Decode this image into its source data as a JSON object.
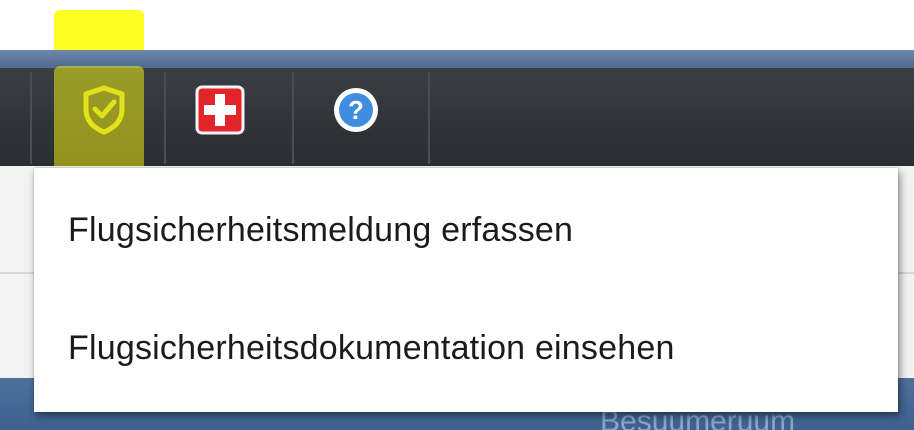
{
  "toolbar": {
    "buttons": [
      {
        "icon": "shield-check-icon",
        "color": "#e2e21a",
        "highlighted": true
      },
      {
        "icon": "first-aid-icon",
        "color": "#e2252b"
      },
      {
        "icon": "help-icon",
        "color": "#3f8de0"
      }
    ]
  },
  "menu": {
    "items": [
      {
        "label": "Flugsicherheitsmeldung erfassen"
      },
      {
        "label": "Flugsicherheitsdokumentation einsehen"
      }
    ]
  },
  "background": {
    "partial_text": "Besuumeruum"
  },
  "colors": {
    "highlight": "#ffff1a",
    "toolbar": "#2f3338",
    "accent_blue": "#4a6588"
  }
}
